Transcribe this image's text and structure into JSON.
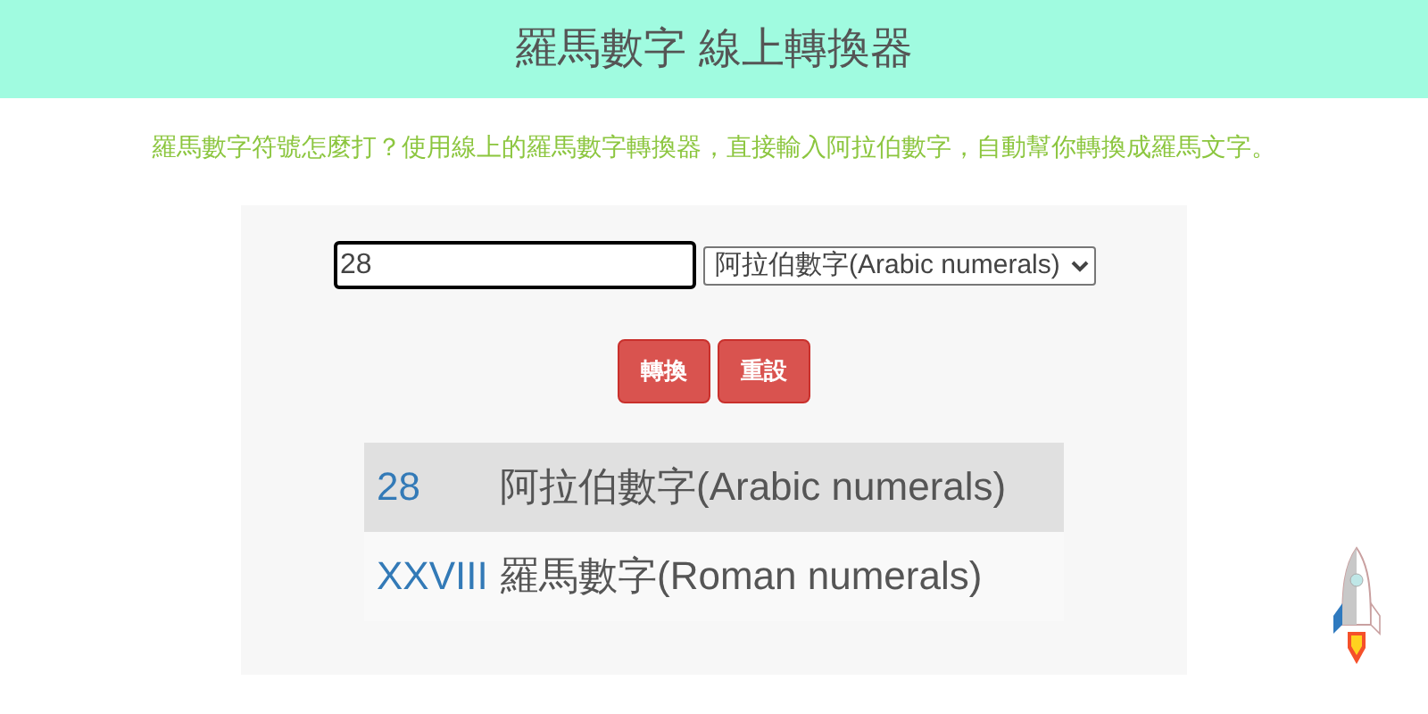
{
  "header": {
    "title": "羅馬數字 線上轉換器"
  },
  "intro": "羅馬數字符號怎麼打？使用線上的羅馬數字轉換器，直接輸入阿拉伯數字，自動幫你轉換成羅馬文字。",
  "form": {
    "value": "28",
    "select": "阿拉伯數字(Arabic numerals)",
    "buttons": [
      "轉換",
      "重設"
    ]
  },
  "results": [
    {
      "value": "28",
      "label": "阿拉伯數字(Arabic numerals)",
      "selected": true
    },
    {
      "value": "XXVIII",
      "label": "羅馬數字(Roman numerals)",
      "selected": false
    }
  ]
}
